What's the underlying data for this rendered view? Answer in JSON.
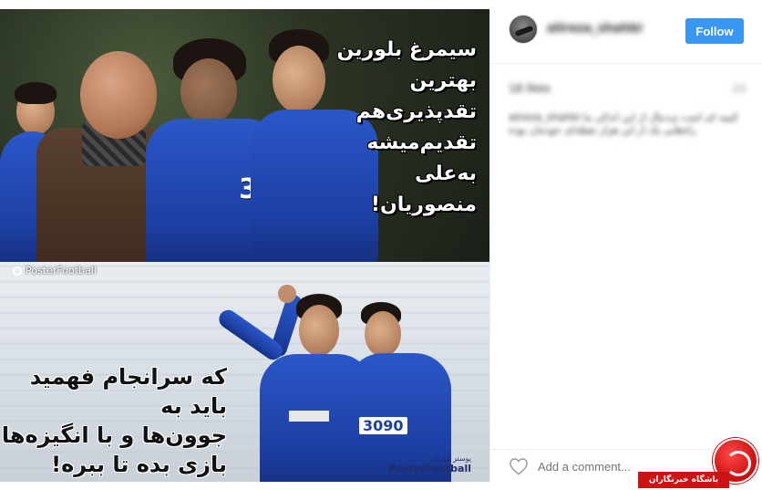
{
  "post": {
    "caption_top_lines": [
      "سیمرغ بلورین",
      "بهترین",
      "تقدپذیری‌هم",
      "تقدیم‌میشه",
      "به‌علی",
      "منصوریان!"
    ],
    "caption_bottom_lines": [
      "که سرانجام فهمید",
      "باید به",
      "جوون‌ها و با انگیزه‌ها",
      "بازی بده‌ تا ببره!"
    ],
    "watermark_top": "PosterFootball",
    "watermark_bottom_small": "پوستر فوتبال",
    "watermark_bottom": "PosterFootball",
    "jersey_number_top": "3",
    "jersey_number_bottom": "3090"
  },
  "header": {
    "username": "alireza_shahbi",
    "follow_label": "Follow"
  },
  "likes": {
    "text": "18 likes",
    "right": "2d"
  },
  "caption": {
    "text": "alireza_shahbi کتیبه ای است ی‌دنبال از این اندکی ما راه‌هایی یک از این هزار نقطه‌ای خودمان بوده"
  },
  "comment": {
    "placeholder": "Add a comment..."
  },
  "logo": {
    "banner": "باشگاه خبرنگاران"
  },
  "colors": {
    "follow_button": "#3897f0",
    "esteghlal_blue": "#1c3fa3",
    "logo_red": "#cc1414"
  }
}
